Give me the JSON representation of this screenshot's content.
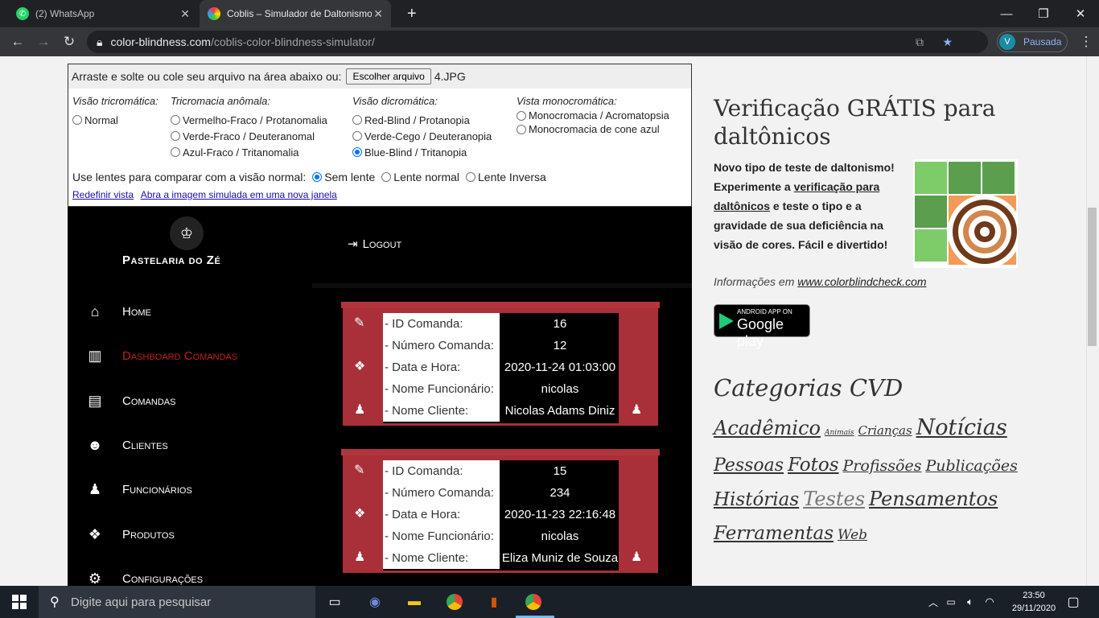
{
  "browser": {
    "tabs": [
      {
        "label": "(2) WhatsApp"
      },
      {
        "label": "Coblis – Simulador de Daltonismo"
      }
    ],
    "url_host": "color-blindness.com",
    "url_path": "/coblis-color-blindness-simulator/",
    "profile": {
      "initial": "V",
      "status": "Pausada"
    }
  },
  "sim": {
    "drop_text": "Arraste e solte ou cole seu arquivo na área abaixo ou:",
    "file_button": "Escolher arquivo",
    "file_name": "4.JPG",
    "groups": [
      {
        "title": "Visão tricromática:",
        "options": [
          "Normal"
        ]
      },
      {
        "title": "Tricromacia anômala:",
        "options": [
          "Vermelho-Fraco / Protanomalia",
          "Verde-Fraco / Deuteranomal",
          "Azul-Fraco / Tritanomalia"
        ]
      },
      {
        "title": "Visão dicromática:",
        "options": [
          "Red-Blind / Protanopia",
          "Verde-Cego / Deuteranopia",
          "Blue-Blind / Tritanopia"
        ]
      },
      {
        "title": "Vista monocromática:",
        "options": [
          "Monocromacia / Acromatopsia",
          "Monocromacia de cone azul"
        ]
      }
    ],
    "selected": "Blue-Blind / Tritanopia",
    "lens_label": "Use lentes para comparar com a visão normal:",
    "lens_options": [
      "Sem lente",
      "Lente normal",
      "Lente Inversa"
    ],
    "lens_selected": "Sem lente",
    "links": [
      "Redefinir vista",
      "Abra a imagem simulada em uma nova janela"
    ]
  },
  "app": {
    "brand": "Pastelaria do Zé",
    "logout": "Logout",
    "nav": [
      {
        "label": "Home",
        "icon": "home-icon",
        "active": false
      },
      {
        "label": "Dashboard Comandas",
        "icon": "bar-chart-icon",
        "active": true
      },
      {
        "label": "Comandas",
        "icon": "id-card-icon",
        "active": false
      },
      {
        "label": "Clientes",
        "icon": "users-icon",
        "active": false
      },
      {
        "label": "Funcionários",
        "icon": "user-icon",
        "active": false
      },
      {
        "label": "Produtos",
        "icon": "cubes-icon",
        "active": false
      },
      {
        "label": "Configurações",
        "icon": "gears-icon",
        "active": false
      }
    ],
    "field_labels": [
      "- ID Comanda:",
      "- Número Comanda:",
      "- Data e Hora:",
      "- Nome Funcionário:",
      "- Nome Cliente:"
    ],
    "cards": [
      {
        "values": [
          "16",
          "12",
          "2020-11-24 01:03:00",
          "nicolas",
          "Nicolas Adams Diniz"
        ]
      },
      {
        "values": [
          "15",
          "234",
          "2020-11-23 22:16:48",
          "nicolas",
          "Eliza Muniz de Souza"
        ]
      }
    ]
  },
  "promo": {
    "title": "Verificação GRÁTIS para daltônicos",
    "text_before": "Novo tipo de teste de daltonismo! Experimente a ",
    "link": "verificação para daltônicos",
    "text_after": " e teste o tipo e a gravidade de sua deficiência na visão de cores. Fácil e divertido!",
    "info_prefix": "Informações em ",
    "info_link": "www.colorblindcheck.com",
    "badge_small": "ANDROID APP ON",
    "badge_big": "Google play"
  },
  "categories": {
    "title": "Categorias CVD",
    "tags": [
      {
        "t": "Acadêmico",
        "s": 24
      },
      {
        "t": "Animais",
        "s": 9
      },
      {
        "t": "Crianças",
        "s": 15
      },
      {
        "t": "Notícias",
        "s": 27
      },
      {
        "t": "Pessoas",
        "s": 22
      },
      {
        "t": "Fotos",
        "s": 23
      },
      {
        "t": "Profissões",
        "s": 19
      },
      {
        "t": "Publicações",
        "s": 19
      },
      {
        "t": "Histórias",
        "s": 23
      },
      {
        "t": "Testes",
        "s": 24
      },
      {
        "t": "Pensamentos",
        "s": 24
      },
      {
        "t": "Ferramentas",
        "s": 23
      },
      {
        "t": "Web",
        "s": 17
      }
    ]
  },
  "taskbar": {
    "search": "Digite aqui para pesquisar",
    "time": "23:50",
    "date": "29/11/2020"
  }
}
